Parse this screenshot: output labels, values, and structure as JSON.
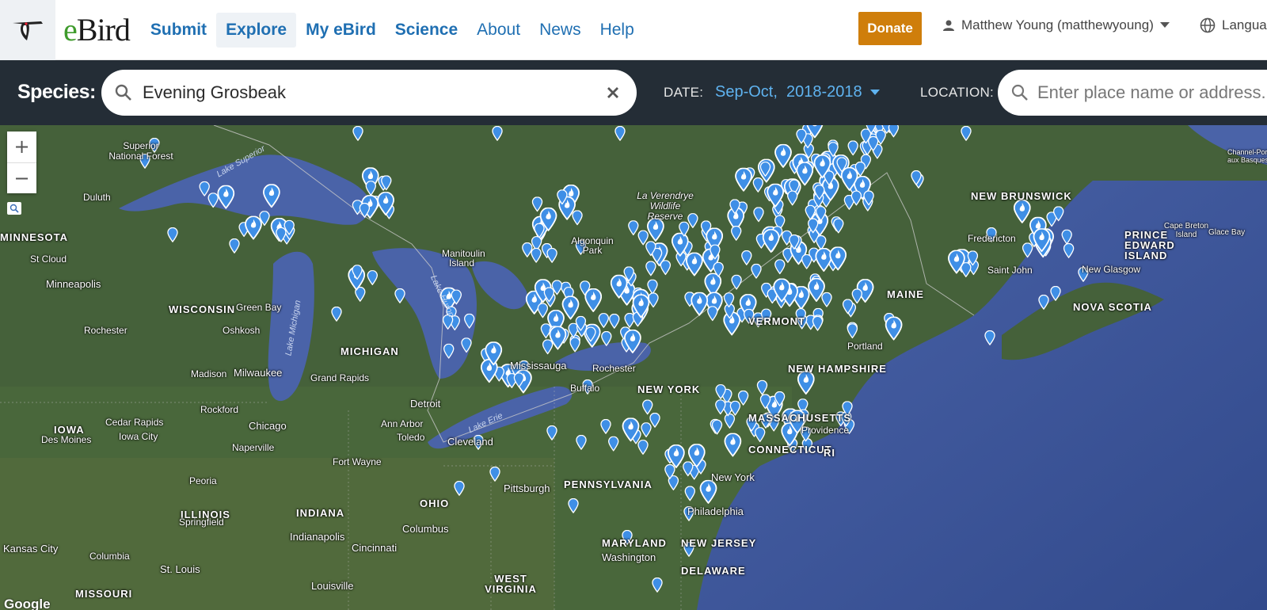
{
  "header": {
    "brand_e": "e",
    "brand_bird": "Bird",
    "nav": [
      {
        "label": "Submit",
        "bold": true
      },
      {
        "label": "Explore",
        "bold": true,
        "active": true
      },
      {
        "label": "My eBird",
        "bold": true
      },
      {
        "label": "Science",
        "bold": true
      },
      {
        "label": "About",
        "bold": false
      },
      {
        "label": "News",
        "bold": false
      },
      {
        "label": "Help",
        "bold": false
      }
    ],
    "donate": "Donate",
    "user": "Matthew Young (matthewyoung)",
    "language": "Language"
  },
  "filters": {
    "species_label": "Species:",
    "species_value": "Evening Grosbeak",
    "date_label": "DATE:",
    "date_value": "Sep-Oct,  2018-2018",
    "location_label": "LOCATION:",
    "location_placeholder": "Enter place name or address..."
  },
  "map": {
    "zoom_in": "+",
    "zoom_out": "−",
    "attribution": "Google",
    "colors": {
      "land": "#3d5a2e",
      "water": "#4a63a8",
      "marker": "#3f8fe6"
    },
    "labels": {
      "states": [
        "MINNESOTA",
        "WISCONSIN",
        "MICHIGAN",
        "IOWA",
        "ILLINOIS",
        "INDIANA",
        "OHIO",
        "PENNSYLVANIA",
        "NEW YORK",
        "MASSACHUSETTS",
        "MAINE",
        "NEW BRUNSWICK",
        "NOVA SCOTIA",
        "PRINCE EDWARD ISLAND",
        "MARYLAND",
        "NEW JERSEY",
        "DELAWARE",
        "WEST VIRGINIA",
        "MISSOURI",
        "VERMONT",
        "NEW HAMPSHIRE",
        "CONNECTICUT",
        "RI"
      ],
      "cities": [
        "Minneapolis",
        "Duluth",
        "St Cloud",
        "Rochester",
        "Oshkosh",
        "Green Bay",
        "Madison",
        "Milwaukee",
        "Grand Rapids",
        "Chicago",
        "Rockford",
        "Cedar Rapids",
        "Iowa City",
        "Des Moines",
        "Naperville",
        "Peoria",
        "Springfield",
        "Detroit",
        "Ann Arbor",
        "Toledo",
        "Cleveland",
        "Fort Wayne",
        "Indianapolis",
        "Columbus",
        "Cincinnati",
        "Pittsburgh",
        "Buffalo",
        "Rochester",
        "Mississauga",
        "Philadelphia",
        "New York",
        "Providence",
        "Portland",
        "Washington",
        "Louisville",
        "St. Louis",
        "Columbia",
        "Kansas City",
        "Fredericton",
        "Saint John",
        "New Glasgow",
        "Cape Breton Island",
        "Glace Bay",
        "Manitoulin Island",
        "Channel-Port aux Basques",
        "Superior National Forest",
        "La Verendrye Wildlife Reserve",
        "Algonquin Park"
      ],
      "water": [
        "Lake Superior",
        "Lake Michigan",
        "Lake Huron",
        "Lake Erie"
      ]
    }
  }
}
